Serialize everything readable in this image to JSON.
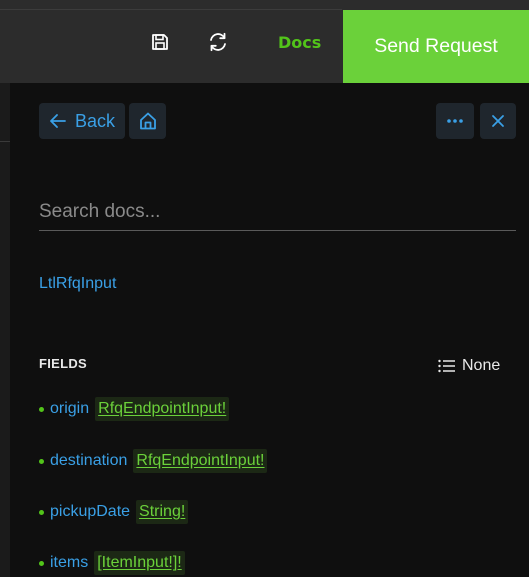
{
  "toolbar": {
    "docs_label": "Docs",
    "send_label": "Send Request",
    "accent_color": "#6bd13a"
  },
  "docs": {
    "back_label": "Back",
    "search_placeholder": "Search docs...",
    "type_name": "LtlRfqInput",
    "fields_heading": "FIELDS",
    "sort_label": "None",
    "fields": [
      {
        "name": "origin",
        "type": "RfqEndpointInput!"
      },
      {
        "name": "destination",
        "type": "RfqEndpointInput!"
      },
      {
        "name": "pickupDate",
        "type": "String!"
      },
      {
        "name": "items",
        "type": "[ItemInput!]!"
      }
    ]
  },
  "icons": {
    "save": "save-icon",
    "reload": "reload-icon",
    "back": "arrow-left-icon",
    "home": "home-icon",
    "more": "more-dots-icon",
    "close": "close-icon",
    "sort": "list-icon"
  }
}
